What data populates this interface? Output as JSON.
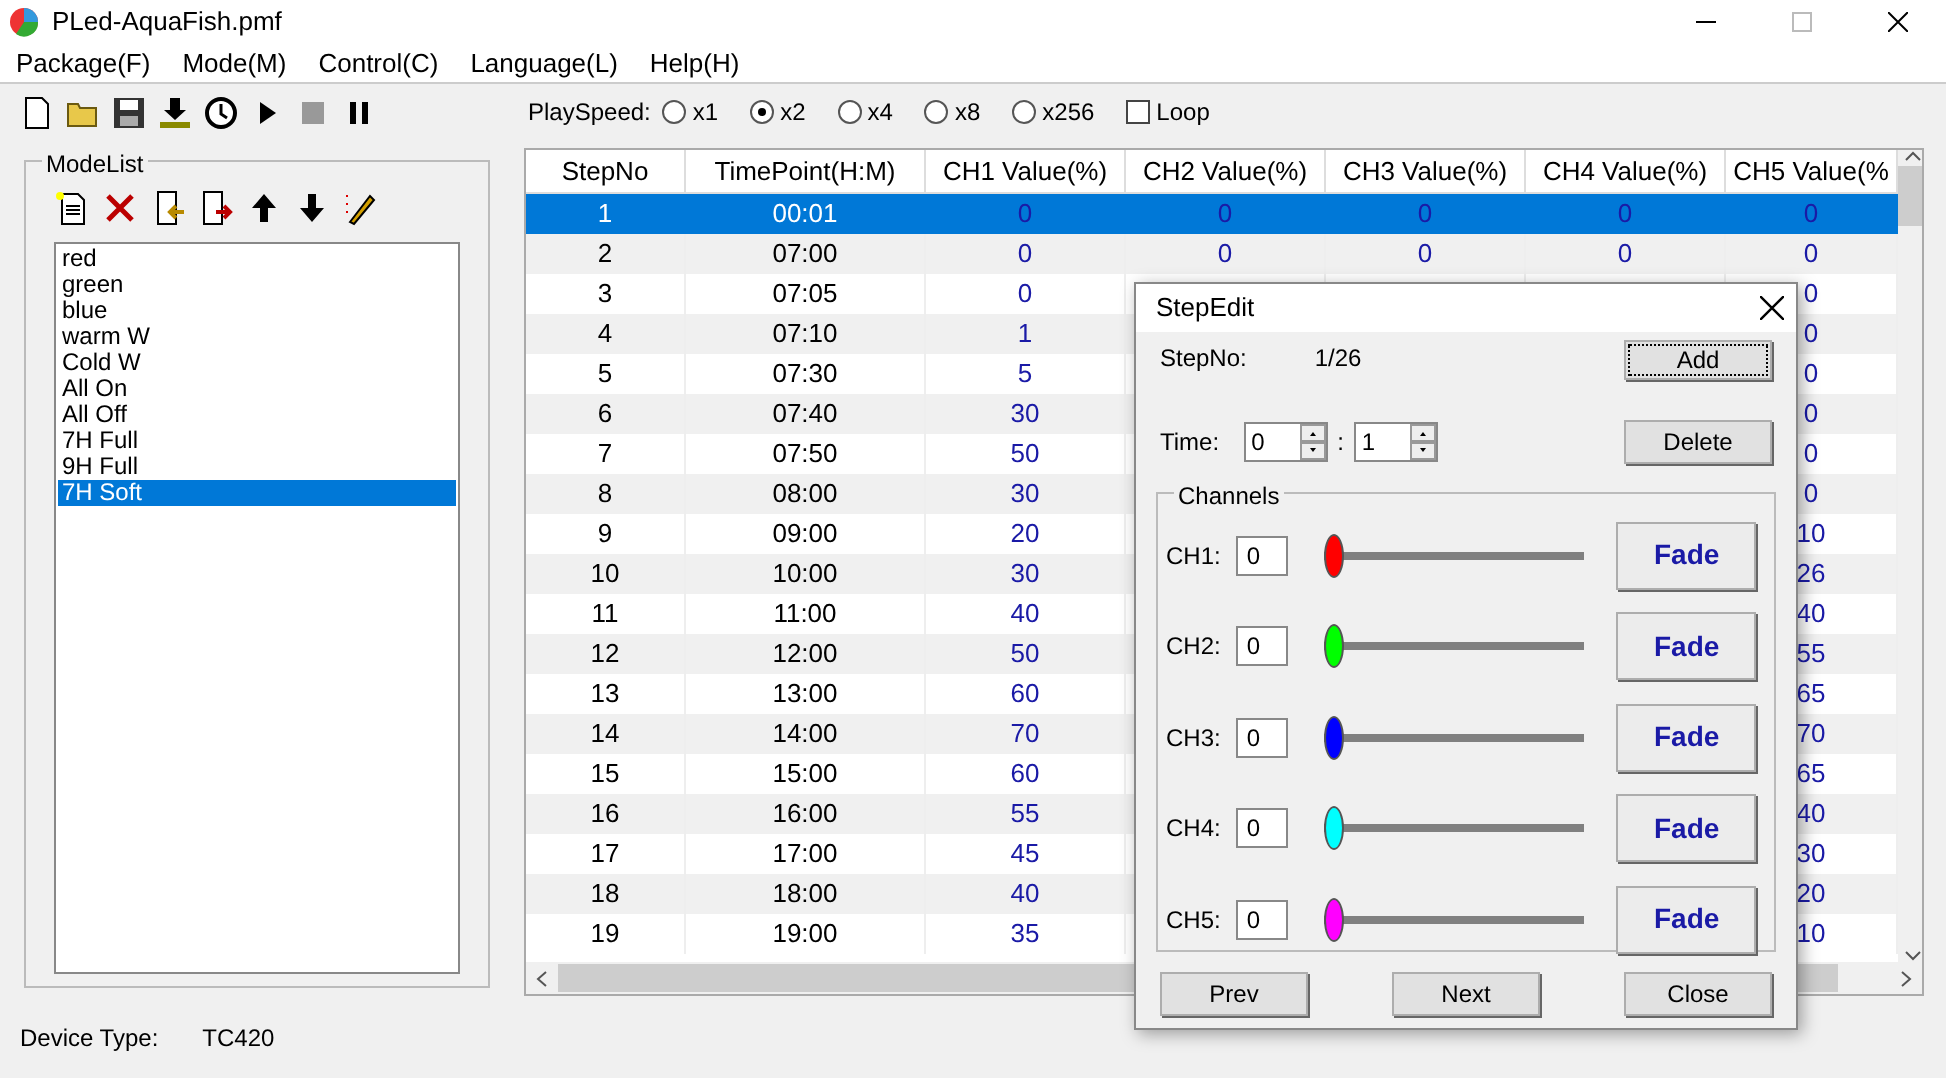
{
  "window": {
    "title": "PLed-AquaFish.pmf"
  },
  "menu": [
    "Package(F)",
    "Mode(M)",
    "Control(C)",
    "Language(L)",
    "Help(H)"
  ],
  "toolbar": {
    "play_speed_label": "PlaySpeed:",
    "speeds": [
      {
        "label": "x1",
        "selected": false
      },
      {
        "label": "x2",
        "selected": true
      },
      {
        "label": "x4",
        "selected": false
      },
      {
        "label": "x8",
        "selected": false
      },
      {
        "label": "x256",
        "selected": false
      }
    ],
    "loop": {
      "label": "Loop",
      "checked": false
    }
  },
  "mode_list": {
    "title": "ModeList",
    "items": [
      {
        "label": "red",
        "selected": false
      },
      {
        "label": "green",
        "selected": false
      },
      {
        "label": "blue",
        "selected": false
      },
      {
        "label": "warm W",
        "selected": false
      },
      {
        "label": "Cold W",
        "selected": false
      },
      {
        "label": "All On",
        "selected": false
      },
      {
        "label": "All Off",
        "selected": false
      },
      {
        "label": "7H Full",
        "selected": false
      },
      {
        "label": "9H Full",
        "selected": false
      },
      {
        "label": "7H Soft",
        "selected": true
      }
    ]
  },
  "table": {
    "columns": [
      "StepNo",
      "TimePoint(H:M)",
      "CH1 Value(%)",
      "CH2 Value(%)",
      "CH3 Value(%)",
      "CH4 Value(%)",
      "CH5 Value(%"
    ],
    "rows": [
      {
        "cells": [
          "1",
          "00:01",
          "0",
          "0",
          "0",
          "0",
          "0"
        ],
        "selected": true
      },
      {
        "cells": [
          "2",
          "07:00",
          "0",
          "0",
          "0",
          "0",
          "0"
        ],
        "selected": false
      },
      {
        "cells": [
          "3",
          "07:05",
          "0",
          null,
          null,
          null,
          "0"
        ],
        "selected": false
      },
      {
        "cells": [
          "4",
          "07:10",
          "1",
          null,
          null,
          null,
          "0"
        ],
        "selected": false
      },
      {
        "cells": [
          "5",
          "07:30",
          "5",
          null,
          null,
          null,
          "0"
        ],
        "selected": false
      },
      {
        "cells": [
          "6",
          "07:40",
          "30",
          null,
          null,
          null,
          "0"
        ],
        "selected": false
      },
      {
        "cells": [
          "7",
          "07:50",
          "50",
          null,
          null,
          null,
          "0"
        ],
        "selected": false
      },
      {
        "cells": [
          "8",
          "08:00",
          "30",
          null,
          null,
          null,
          "0"
        ],
        "selected": false
      },
      {
        "cells": [
          "9",
          "09:00",
          "20",
          null,
          null,
          null,
          "10"
        ],
        "selected": false
      },
      {
        "cells": [
          "10",
          "10:00",
          "30",
          null,
          null,
          null,
          "26"
        ],
        "selected": false
      },
      {
        "cells": [
          "11",
          "11:00",
          "40",
          null,
          null,
          null,
          "40"
        ],
        "selected": false
      },
      {
        "cells": [
          "12",
          "12:00",
          "50",
          null,
          null,
          null,
          "55"
        ],
        "selected": false
      },
      {
        "cells": [
          "13",
          "13:00",
          "60",
          null,
          null,
          null,
          "65"
        ],
        "selected": false
      },
      {
        "cells": [
          "14",
          "14:00",
          "70",
          null,
          null,
          null,
          "70"
        ],
        "selected": false
      },
      {
        "cells": [
          "15",
          "15:00",
          "60",
          null,
          null,
          null,
          "65"
        ],
        "selected": false
      },
      {
        "cells": [
          "16",
          "16:00",
          "55",
          null,
          null,
          null,
          "40"
        ],
        "selected": false
      },
      {
        "cells": [
          "17",
          "17:00",
          "45",
          null,
          null,
          null,
          "30"
        ],
        "selected": false
      },
      {
        "cells": [
          "18",
          "18:00",
          "40",
          null,
          null,
          null,
          "20"
        ],
        "selected": false
      },
      {
        "cells": [
          "19",
          "19:00",
          "35",
          null,
          null,
          null,
          "10"
        ],
        "selected": false
      }
    ]
  },
  "status_bar": {
    "label": "Device Type:",
    "value": "TC420"
  },
  "step_edit": {
    "title": "StepEdit",
    "step_label": "StepNo:",
    "step_value": "1/26",
    "time_label": "Time:",
    "hour": "0",
    "minute": "1",
    "separator": ":",
    "add_button": "Add",
    "delete_button": "Delete",
    "channels_title": "Channels",
    "channels": [
      {
        "label": "CH1:",
        "value": "0",
        "level": 0,
        "color": "#ff0000",
        "button": "Fade"
      },
      {
        "label": "CH2:",
        "value": "0",
        "level": 0,
        "color": "#00ff00",
        "button": "Fade"
      },
      {
        "label": "CH3:",
        "value": "0",
        "level": 0,
        "color": "#0000ff",
        "button": "Fade"
      },
      {
        "label": "CH4:",
        "value": "0",
        "level": 0,
        "color": "#00ffff",
        "button": "Fade"
      },
      {
        "label": "CH5:",
        "value": "0",
        "level": 0,
        "color": "#ff00ff",
        "button": "Fade"
      }
    ],
    "buttons": [
      "Prev",
      "Next",
      "Close"
    ]
  }
}
